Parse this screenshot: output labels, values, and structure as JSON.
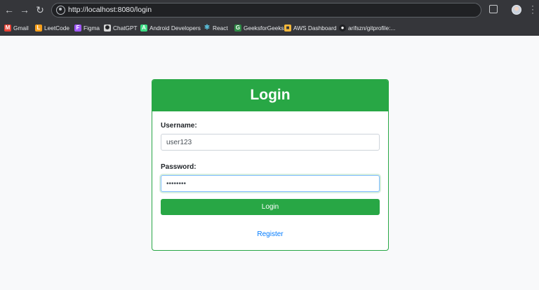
{
  "browser": {
    "url": "http://localhost:8080/login",
    "bookmarks": [
      {
        "label": "Gmail",
        "icon": "gmail-icon",
        "color": "#ea4335"
      },
      {
        "label": "LeetCode",
        "icon": "leetcode-icon",
        "color": "#f89f1b"
      },
      {
        "label": "Figma",
        "icon": "figma-icon",
        "color": "#a259ff"
      },
      {
        "label": "ChatGPT",
        "icon": "chatgpt-icon",
        "color": "#d9d9d9"
      },
      {
        "label": "Android Developers",
        "icon": "android-icon",
        "color": "#3ddc84"
      },
      {
        "label": "React",
        "icon": "react-icon",
        "color": "#61dafb"
      },
      {
        "label": "GeeksforGeeks",
        "icon": "geeksforgeeks-icon",
        "color": "#2f8d46"
      },
      {
        "label": "AWS Dashboard",
        "icon": "aws-icon",
        "color": "#f6b93b"
      },
      {
        "label": "arifszn/gitprofile:...",
        "icon": "github-icon",
        "color": "#202124"
      }
    ]
  },
  "login": {
    "title": "Login",
    "username_label": "Username:",
    "username_value": "user123",
    "password_label": "Password:",
    "password_value": "••••••••",
    "submit_label": "Login",
    "register_label": "Register",
    "accent_color": "#28a745",
    "link_color": "#007bff"
  }
}
